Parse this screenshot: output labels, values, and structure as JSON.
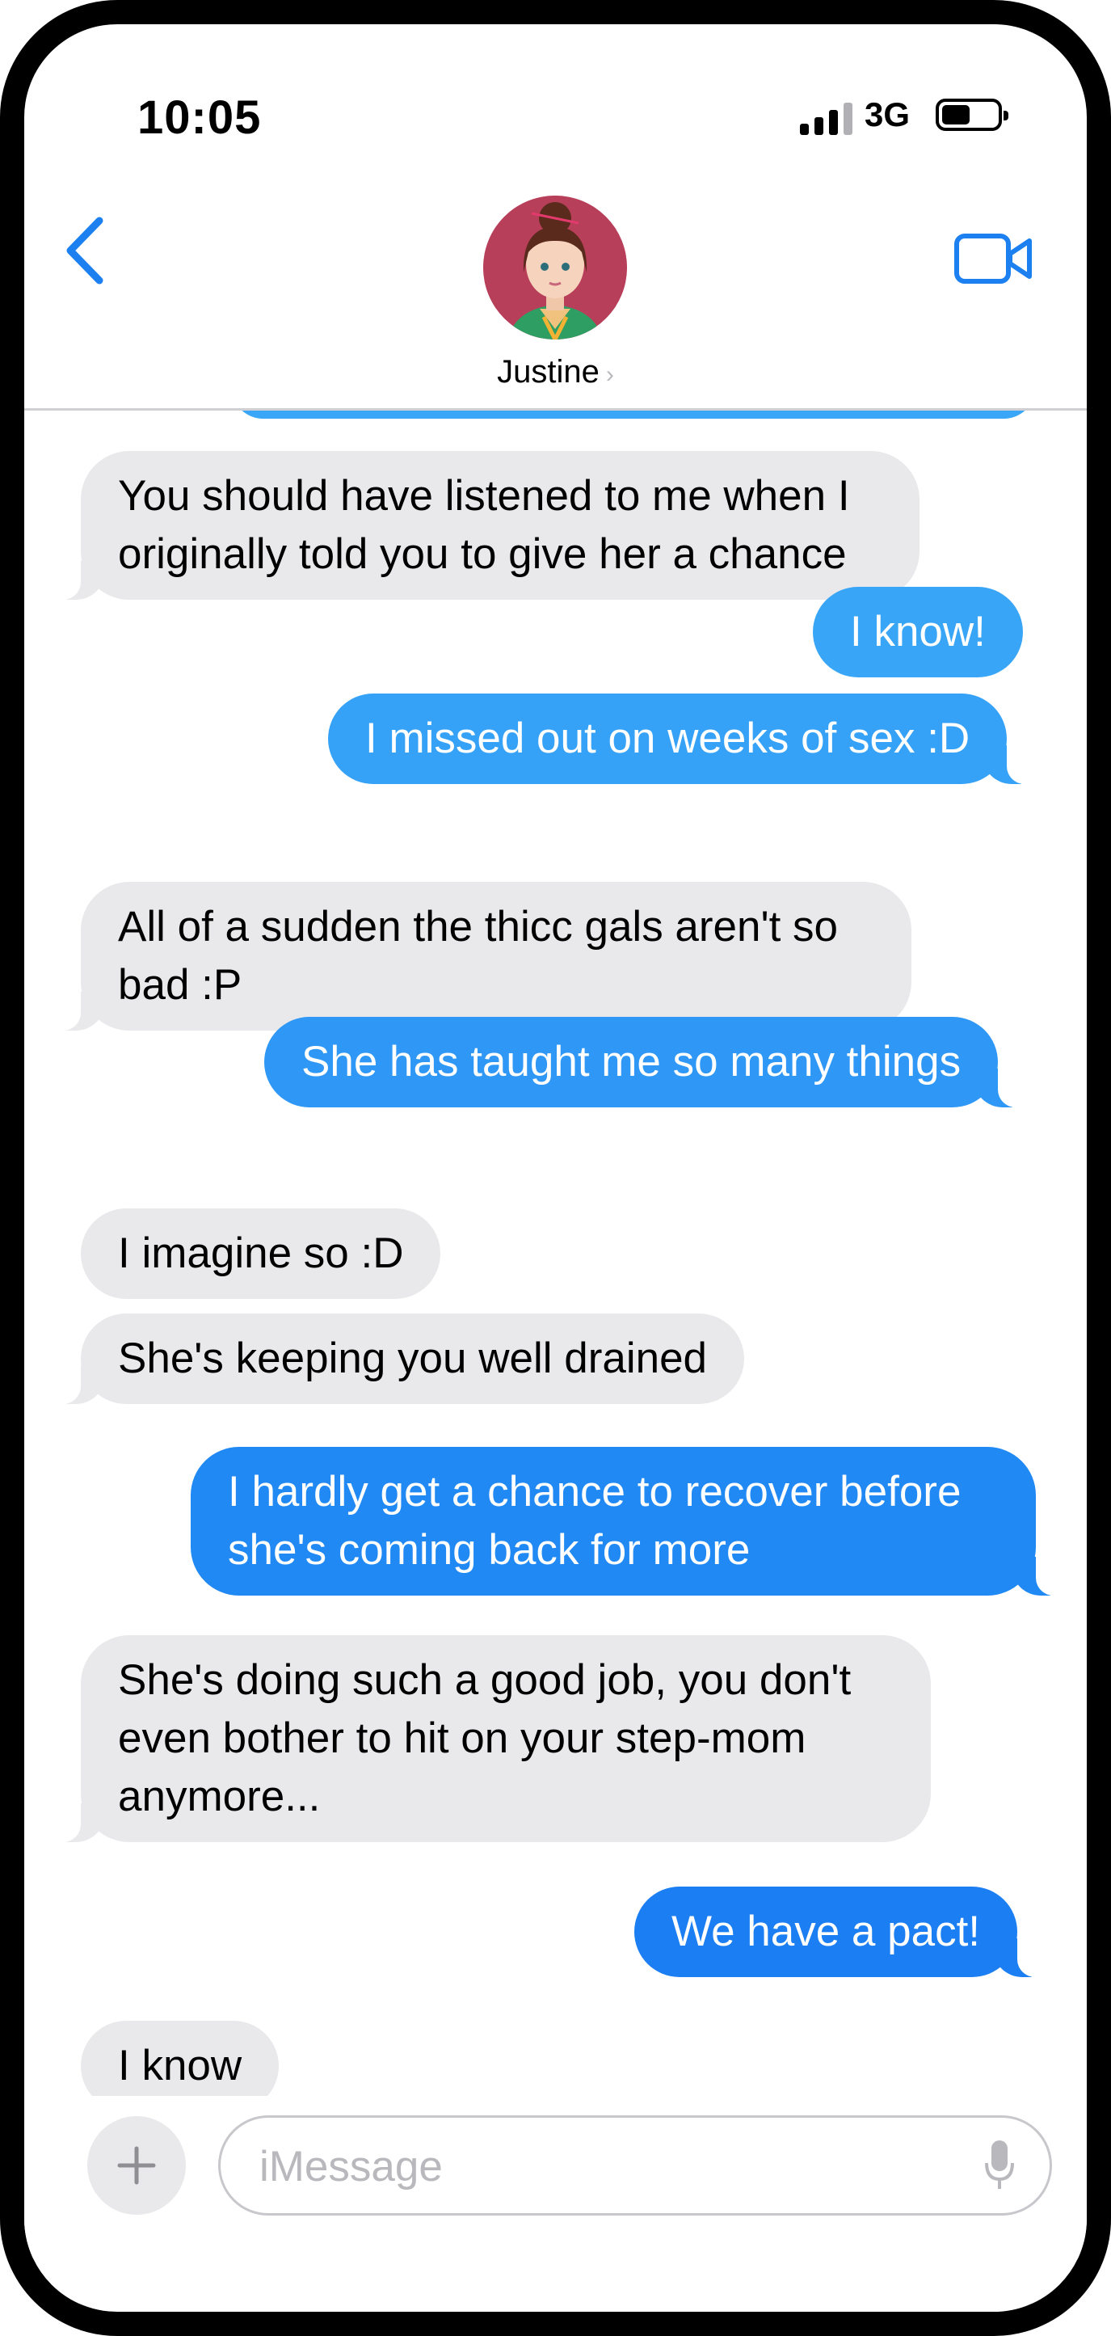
{
  "status_bar": {
    "time": "10:05",
    "network": "3G"
  },
  "header": {
    "contact_name": "Justine"
  },
  "messages": [
    {
      "from": "them",
      "text": "You should have listened to me when I originally told you to give her a chance"
    },
    {
      "from": "me",
      "text": "I know!"
    },
    {
      "from": "me",
      "text": "I missed out on weeks of sex :D"
    },
    {
      "from": "them",
      "text": "All of a sudden the thicc gals aren't so bad :P"
    },
    {
      "from": "me",
      "text": "She has taught me so many things"
    },
    {
      "from": "them",
      "text": "I imagine so :D"
    },
    {
      "from": "them",
      "text": "She's keeping you well drained"
    },
    {
      "from": "me",
      "text": "I hardly get a chance to recover before she's coming back for more"
    },
    {
      "from": "them",
      "text": "She's doing such a good job, you don't even bother to hit on your step-mom anymore..."
    },
    {
      "from": "me",
      "text": "We have a pact!"
    },
    {
      "from": "them",
      "text": "I know"
    }
  ],
  "composer": {
    "placeholder": "iMessage"
  },
  "colors": {
    "accent": "#1d80f0",
    "incoming_bubble": "#e9e9eb",
    "outgoing_top": "#3aa6f7",
    "outgoing_bottom": "#1b7ef2"
  },
  "icons": {
    "back": "chevron-left-icon",
    "video": "video-camera-icon",
    "plus": "plus-icon",
    "mic": "microphone-icon",
    "info": "chevron-right-icon"
  }
}
